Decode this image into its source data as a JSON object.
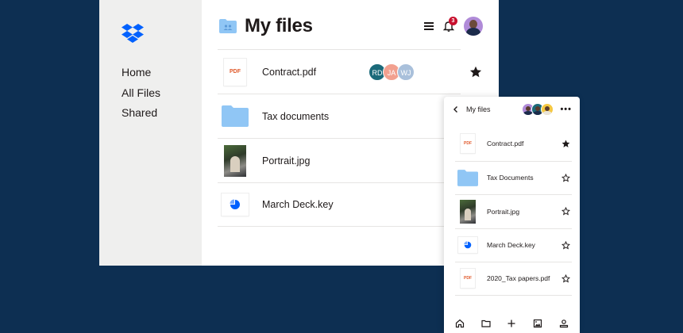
{
  "desktop": {
    "title": "My files",
    "nav": [
      "Home",
      "All Files",
      "Shared"
    ],
    "notifications_count": "3",
    "files": [
      {
        "name": "Contract.pdf",
        "thumb": "pdf",
        "thumb_label": "PDF",
        "collaborators": [
          {
            "initials": "RD",
            "color": "#1b6a7a"
          },
          {
            "initials": "JA",
            "color": "#f2a08f"
          },
          {
            "initials": "WJ",
            "color": "#a9c0db"
          }
        ],
        "starred": true
      },
      {
        "name": "Tax documents",
        "thumb": "folder"
      },
      {
        "name": "Portrait.jpg",
        "thumb": "photo"
      },
      {
        "name": "March Deck.key",
        "thumb": "keynote"
      }
    ]
  },
  "mobile": {
    "title": "My files",
    "files": [
      {
        "name": "Contract.pdf",
        "thumb": "pdf",
        "thumb_label": "PDF",
        "starred": true
      },
      {
        "name": "Tax Documents",
        "thumb": "folder",
        "starred": false
      },
      {
        "name": "Portrait.jpg",
        "thumb": "photo",
        "starred": false
      },
      {
        "name": "March Deck.key",
        "thumb": "keynote",
        "starred": false
      },
      {
        "name": "2020_Tax papers.pdf",
        "thumb": "pdf",
        "thumb_label": "PDF",
        "starred": false
      }
    ],
    "tabs": [
      "home-icon",
      "folder-icon",
      "plus-icon",
      "photos-icon",
      "account-icon"
    ]
  },
  "colors": {
    "background": "#0d2f52",
    "sidebar": "#efefee",
    "brand_blue": "#0061fe",
    "folder_blue": "#90c6f5",
    "badge_red": "#c8102e",
    "pdf_orange": "#e0592a"
  }
}
